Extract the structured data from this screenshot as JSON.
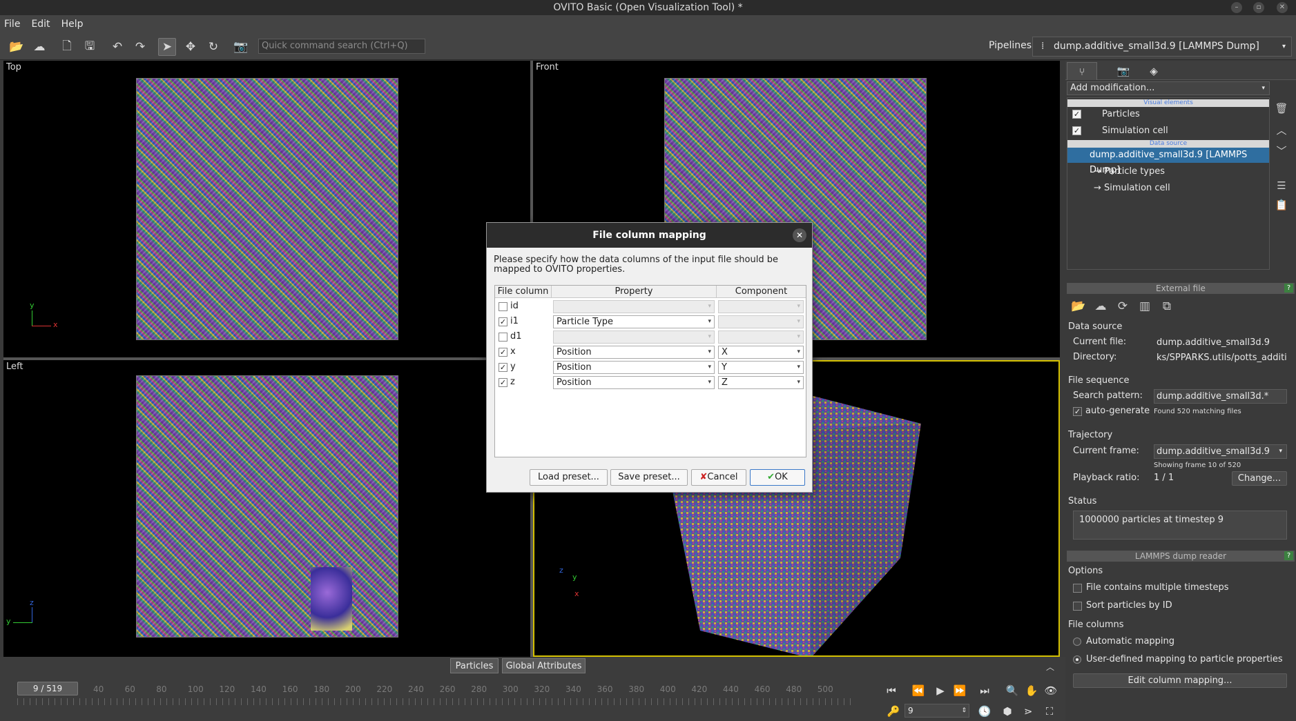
{
  "window": {
    "title": "OVITO Basic (Open Visualization Tool) *"
  },
  "menu": [
    "File",
    "Edit",
    "Help"
  ],
  "toolbar": {
    "search_placeholder": "Quick command search (Ctrl+Q)",
    "pipelines_label": "Pipelines:",
    "pipeline_selected": "dump.additive_small3d.9 [LAMMPS Dump]"
  },
  "viewports": [
    {
      "label": "Top"
    },
    {
      "label": "Front"
    },
    {
      "label": "Left"
    },
    {
      "label": ""
    }
  ],
  "axes": {
    "top": [
      "y",
      "x"
    ],
    "left": [
      "z",
      "y"
    ],
    "persp": [
      "z",
      "y",
      "x"
    ]
  },
  "dialog": {
    "title": "File column mapping",
    "description": "Please specify how the data columns of the input file should be mapped to OVITO properties.",
    "headers": [
      "File column",
      "Property",
      "Component"
    ],
    "rows": [
      {
        "column": "id",
        "checked": false,
        "property": "",
        "component": ""
      },
      {
        "column": "i1",
        "checked": true,
        "property": "Particle Type",
        "component": ""
      },
      {
        "column": "d1",
        "checked": false,
        "property": "",
        "component": ""
      },
      {
        "column": "x",
        "checked": true,
        "property": "Position",
        "component": "X"
      },
      {
        "column": "y",
        "checked": true,
        "property": "Position",
        "component": "Y"
      },
      {
        "column": "z",
        "checked": true,
        "property": "Position",
        "component": "Z"
      }
    ],
    "buttons": {
      "load": "Load preset...",
      "save": "Save preset...",
      "cancel": "Cancel",
      "ok": "OK"
    }
  },
  "panel": {
    "add_modification": "Add modification...",
    "visual_elements_header": "Visual elements",
    "visual_elements": [
      "Particles",
      "Simulation cell"
    ],
    "data_source_header": "Data source",
    "data_source_item": "dump.additive_small3d.9 [LAMMPS Dump]",
    "sub_items": [
      "→ Particle types",
      "→ Simulation cell"
    ],
    "external_file": {
      "title": "External file",
      "data_source": "Data source",
      "current_file_label": "Current file:",
      "current_file": "dump.additive_small3d.9",
      "directory_label": "Directory:",
      "directory": "ks/SPPARKS.utils/potts_additive",
      "file_sequence": "File sequence",
      "search_pattern_label": "Search pattern:",
      "search_pattern": "dump.additive_small3d.*",
      "auto_generate": "auto-generate",
      "found_files": "Found 520 matching files",
      "trajectory": "Trajectory",
      "current_frame_label": "Current frame:",
      "current_frame": "dump.additive_small3d.9",
      "showing_frame": "Showing frame 10 of 520",
      "playback_label": "Playback ratio:",
      "playback_value": "1 / 1",
      "change_button": "Change...",
      "status_label": "Status",
      "status_text": "1000000 particles at timestep 9"
    },
    "lammps": {
      "title": "LAMMPS dump reader",
      "options": "Options",
      "multiple_timesteps": "File contains multiple timesteps",
      "sort_by_id": "Sort particles by ID",
      "file_columns": "File columns",
      "automatic_mapping": "Automatic mapping",
      "user_mapping": "User-defined mapping to particle properties",
      "edit_button": "Edit column mapping..."
    }
  },
  "bottom": {
    "tabs": [
      "Particles",
      "Global Attributes"
    ],
    "frame_indicator": "9 / 519",
    "ticks": [
      "40",
      "60",
      "80",
      "100",
      "120",
      "140",
      "160",
      "180",
      "200",
      "220",
      "240",
      "260",
      "280",
      "300",
      "320",
      "340",
      "360",
      "380",
      "400",
      "420",
      "440",
      "460",
      "480",
      "500"
    ],
    "frame_spinner": "9"
  },
  "colors": {
    "selection": "#2f6ea0",
    "active_viewport_border": "#d4c000"
  }
}
